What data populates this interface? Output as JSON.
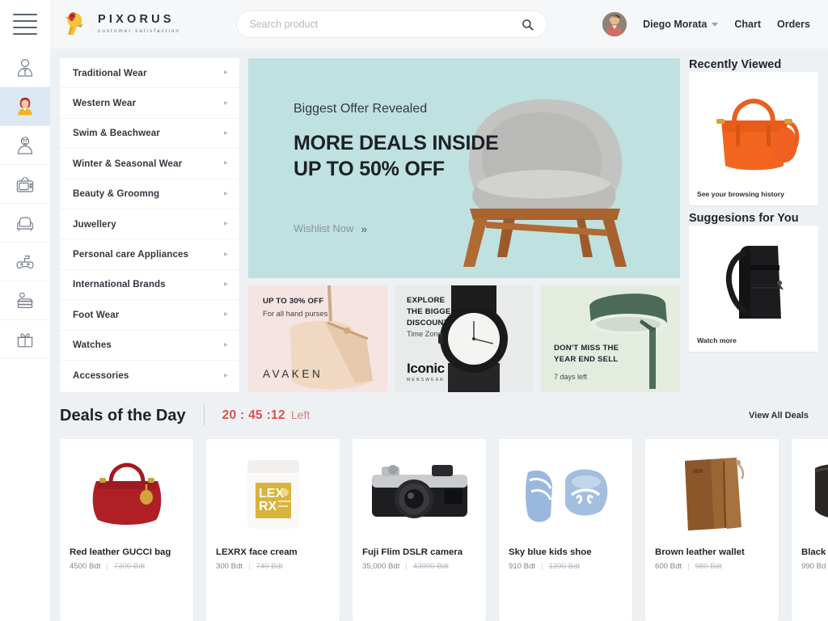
{
  "header": {
    "menu_icon": "hamburger-icon",
    "brand": {
      "name": "PIXORUS",
      "tagline": "customer satisfaction",
      "logo": "parrot-logo-icon"
    },
    "search": {
      "placeholder": "Search product",
      "value": "",
      "icon": "search-icon"
    },
    "user": {
      "name": "Diego Morata",
      "avatar": "user-avatar",
      "caret": "chevron-down-icon"
    },
    "nav": [
      {
        "label": "Chart"
      },
      {
        "label": "Orders"
      }
    ]
  },
  "rail": [
    {
      "icon": "man-icon",
      "name": "men",
      "active": false
    },
    {
      "icon": "woman-icon",
      "name": "women",
      "active": true
    },
    {
      "icon": "kid-icon",
      "name": "kids",
      "active": false
    },
    {
      "icon": "tv-icon",
      "name": "electronics",
      "active": false
    },
    {
      "icon": "sofa-icon",
      "name": "furniture",
      "active": false
    },
    {
      "icon": "gamepad-icon",
      "name": "gaming",
      "active": false
    },
    {
      "icon": "books-icon",
      "name": "books",
      "active": false
    },
    {
      "icon": "gift-icon",
      "name": "gifts",
      "active": false
    }
  ],
  "categories": [
    {
      "label": "Traditional Wear"
    },
    {
      "label": "Western Wear"
    },
    {
      "label": "Swim & Beachwear"
    },
    {
      "label": "Winter & Seasonal Wear"
    },
    {
      "label": "Beauty & Groomng"
    },
    {
      "label": "Juwellery"
    },
    {
      "label": "Personal care Appliances"
    },
    {
      "label": "International Brands"
    },
    {
      "label": "Foot Wear"
    },
    {
      "label": "Watches"
    },
    {
      "label": "Accessories"
    }
  ],
  "hero": {
    "kicker": "Biggest Offer Revealed",
    "title_line1": "MORE DEALS INSIDE",
    "title_line2": "UP TO 50% OFF",
    "cta": "Wishlist Now",
    "cta_arrows": "»",
    "image": "grey-armchair",
    "bg_color": "#bfe1e0"
  },
  "promos": [
    {
      "name": "handbag-promo",
      "head": "UP TO 30% OFF",
      "sub": "For all hand purses",
      "brand": "AVAKEN",
      "bg_color": "#f6e4e2",
      "image": "beige-purse"
    },
    {
      "name": "watch-promo",
      "head_line1": "EXPLORE",
      "head_line2": "THE BIGGEST",
      "head_line3": "DISCOUNT",
      "sub": "Time Zone",
      "brand": "Iconic",
      "brand_sub": "MENSWEAR",
      "bg_color": "#e9eaea",
      "image": "black-watch"
    },
    {
      "name": "lamp-promo",
      "head_line1": "DON'T MISS THE",
      "head_line2": "YEAR END SELL",
      "sub": "7 days left",
      "bg_color": "#e4ece0",
      "image": "green-lamp"
    }
  ],
  "right": {
    "recently_viewed": {
      "title": "Recently Viewed",
      "link": "See your browsing history",
      "image": "orange-handbag"
    },
    "suggestions": {
      "title": "Suggesions for You",
      "link": "Watch more",
      "image": "black-backpack"
    }
  },
  "deals": {
    "title": "Deals of the Day",
    "timer": "20 : 45 :12",
    "timer_suffix": "Left",
    "view_all": "View All Deals",
    "timer_color": "#d9534f",
    "items": [
      {
        "name": "Red leather GUCCI bag",
        "price": "4500 Bdt",
        "old_price": "7300 Bdt",
        "image": "red-handbag"
      },
      {
        "name": "LEXRX face cream",
        "price": "300 Bdt",
        "old_price": "740 Bdt",
        "image": "cream-jar"
      },
      {
        "name": "Fuji Flim DSLR camera",
        "price": "35,000 Bdt",
        "old_price": "43990 Bdt",
        "image": "dslr-camera"
      },
      {
        "name": "Sky blue kids shoe",
        "price": "910 Bdt",
        "old_price": "1390 Bdt",
        "image": "blue-kids-shoes"
      },
      {
        "name": "Brown leather wallet",
        "price": "600 Bdt",
        "old_price": "980 Bdt",
        "image": "brown-wallet"
      },
      {
        "name": "Black",
        "price": "990 Bd",
        "old_price": "",
        "image": "black-item"
      }
    ]
  }
}
